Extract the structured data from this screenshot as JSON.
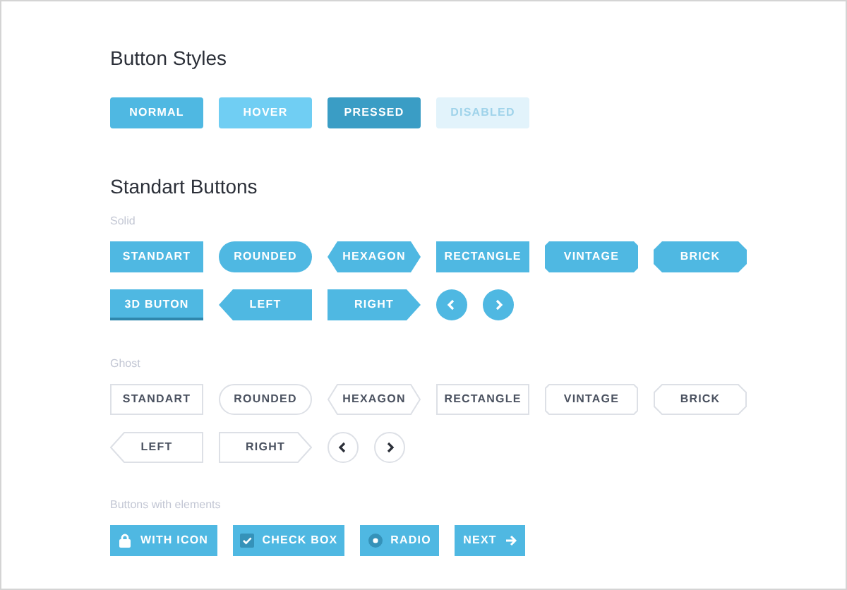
{
  "button_styles": {
    "title": "Button Styles",
    "buttons": [
      {
        "label": "NORMAL",
        "kind": "normal"
      },
      {
        "label": "HOVER",
        "kind": "hover"
      },
      {
        "label": "PRESSED",
        "kind": "pressed"
      },
      {
        "label": "DISABLED",
        "kind": "disabled"
      }
    ]
  },
  "standart_buttons": {
    "title": "Standart Buttons",
    "groups": [
      {
        "label": "Solid",
        "kind": "solid",
        "rows": [
          [
            {
              "label": "STANDART",
              "kind": "standart"
            },
            {
              "label": "ROUNDED",
              "kind": "rounded"
            },
            {
              "label": "HEXAGON",
              "kind": "hexagon"
            },
            {
              "label": "RECTANGLE",
              "kind": "rectangle"
            },
            {
              "label": "VINTAGE",
              "kind": "vintage"
            },
            {
              "label": "BRICK",
              "kind": "brick"
            }
          ],
          [
            {
              "label": "3D BUTON",
              "kind": "raised"
            },
            {
              "label": "LEFT",
              "kind": "left"
            },
            {
              "label": "RIGHT",
              "kind": "right"
            },
            {
              "kind": "prev"
            },
            {
              "kind": "next"
            }
          ]
        ]
      },
      {
        "label": "Ghost",
        "kind": "ghost",
        "rows": [
          [
            {
              "label": "STANDART",
              "kind": "standart"
            },
            {
              "label": "ROUNDED",
              "kind": "rounded"
            },
            {
              "label": "HEXAGON",
              "kind": "hexagon"
            },
            {
              "label": "RECTANGLE",
              "kind": "rectangle"
            },
            {
              "label": "VINTAGE",
              "kind": "vintage"
            },
            {
              "label": "BRICK",
              "kind": "brick"
            }
          ],
          [
            {
              "label": "LEFT",
              "kind": "left"
            },
            {
              "label": "RIGHT",
              "kind": "right"
            },
            {
              "kind": "prev"
            },
            {
              "kind": "next"
            }
          ]
        ]
      },
      {
        "label": "Buttons with elements",
        "kind": "solid",
        "rows": [
          [
            {
              "label": "WITH ICON",
              "kind": "icon"
            },
            {
              "label": "CHECK BOX",
              "kind": "checkbox",
              "checked": true
            },
            {
              "label": "RADIO",
              "kind": "radio",
              "selected": true
            },
            {
              "label": "NEXT",
              "kind": "arrow"
            }
          ]
        ]
      }
    ]
  }
}
